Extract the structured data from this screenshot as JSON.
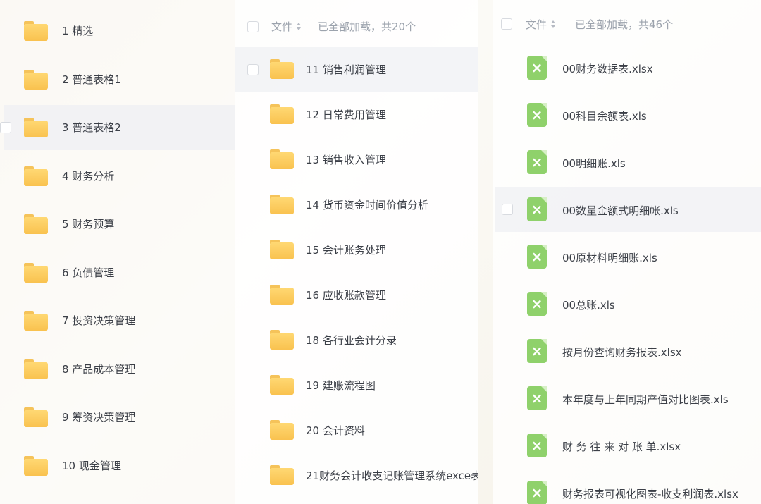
{
  "panel1": {
    "folders": [
      {
        "label": "1 精选"
      },
      {
        "label": "2 普通表格1"
      },
      {
        "label": "3 普通表格2"
      },
      {
        "label": "4 财务分析"
      },
      {
        "label": "5 财务预算"
      },
      {
        "label": "6 负债管理"
      },
      {
        "label": "7 投资决策管理"
      },
      {
        "label": "8 产品成本管理"
      },
      {
        "label": "9 筹资决策管理"
      },
      {
        "label": "10 现金管理"
      }
    ]
  },
  "panel2": {
    "header": {
      "column_label": "文件",
      "load_status": "已全部加载，共20个"
    },
    "folders": [
      {
        "label": "11 销售利润管理"
      },
      {
        "label": "12 日常费用管理"
      },
      {
        "label": "13 销售收入管理"
      },
      {
        "label": "14 货币资金时间价值分析"
      },
      {
        "label": "15 会计账务处理"
      },
      {
        "label": "16 应收账款管理"
      },
      {
        "label": "18 各行业会计分录"
      },
      {
        "label": "19 建账流程图"
      },
      {
        "label": "20 会计资料"
      },
      {
        "label": "21财务会计收支记账管理系统exce表"
      }
    ]
  },
  "panel3": {
    "header": {
      "column_label": "文件",
      "load_status": "已全部加载，共46个"
    },
    "files": [
      {
        "label": "00财务数据表.xlsx"
      },
      {
        "label": "00科目余额表.xls"
      },
      {
        "label": "00明细账.xls"
      },
      {
        "label": "00数量金额式明细帐.xls"
      },
      {
        "label": "00原材料明细账.xls"
      },
      {
        "label": "00总账.xls"
      },
      {
        "label": "按月份查询财务报表.xlsx"
      },
      {
        "label": "本年度与上年同期产值对比图表.xls"
      },
      {
        "label": "财 务 往 来 对 账 单.xlsx"
      },
      {
        "label": "财务报表可视化图表-收支利润表.xlsx"
      }
    ]
  },
  "icons": {
    "folder": "folder-icon",
    "spreadsheet": "excel-file-icon",
    "sort": "sort-icon",
    "checkbox": "checkbox"
  },
  "colors": {
    "folder_yellow": "#f9c24f",
    "excel_green": "#8fd16b",
    "muted_text": "#9ca3ad",
    "hover_row": "#eceef2"
  }
}
